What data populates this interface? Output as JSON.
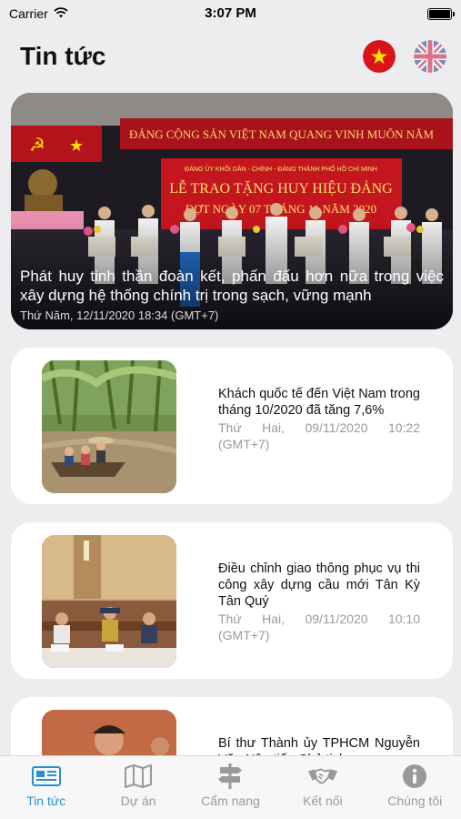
{
  "status": {
    "carrier": "Carrier",
    "time": "3:07 PM"
  },
  "header": {
    "title": "Tin tức"
  },
  "hero": {
    "title": "Phát huy tinh thần đoàn kết, phấn đấu hơn nữa trong việc xây dựng hệ thống chính trị trong sạch, vững mạnh",
    "time": "Thứ Năm, 12/11/2020 18:34 (GMT+7)",
    "banner_top": "ĐẢNG CỘNG SẢN VIỆT NAM QUANG VINH MUÔN NĂM",
    "banner_sub": "ĐẢNG ỦY KHỐI DÂN - CHÍNH - ĐẢNG THÀNH PHỐ HỒ CHÍ MINH",
    "banner_main1": "LỄ TRAO TẶNG HUY HIỆU ĐẢNG",
    "banner_main2": "ĐỢT NGÀY 07 THÁNG 11 NĂM 2020"
  },
  "articles": [
    {
      "title": "Khách quốc tế đến Việt Nam trong tháng 10/2020 đã tăng 7,6%",
      "time": "Thứ Hai, 09/11/2020 10:22 (GMT+7)"
    },
    {
      "title": "Điều chỉnh giao thông phục vụ thi công xây dựng cầu mới Tân Kỳ Tân Quý",
      "time": "Thứ Hai, 09/11/2020 10:10 (GMT+7)"
    },
    {
      "title": "Bí thư Thành ủy TPHCM Nguyễn Văn Nên tiếp Chủ tịch",
      "time": ""
    }
  ],
  "tabs": [
    {
      "label": "Tin tức",
      "icon": "newspaper-icon",
      "active": true
    },
    {
      "label": "Dự án",
      "icon": "map-icon",
      "active": false
    },
    {
      "label": "Cẩm nang",
      "icon": "signpost-icon",
      "active": false
    },
    {
      "label": "Kết nối",
      "icon": "handshake-icon",
      "active": false
    },
    {
      "label": "Chúng tôi",
      "icon": "info-icon",
      "active": false
    }
  ],
  "colors": {
    "accent": "#2a8fd6",
    "inactive": "#999999",
    "party_red": "#c0141c"
  }
}
